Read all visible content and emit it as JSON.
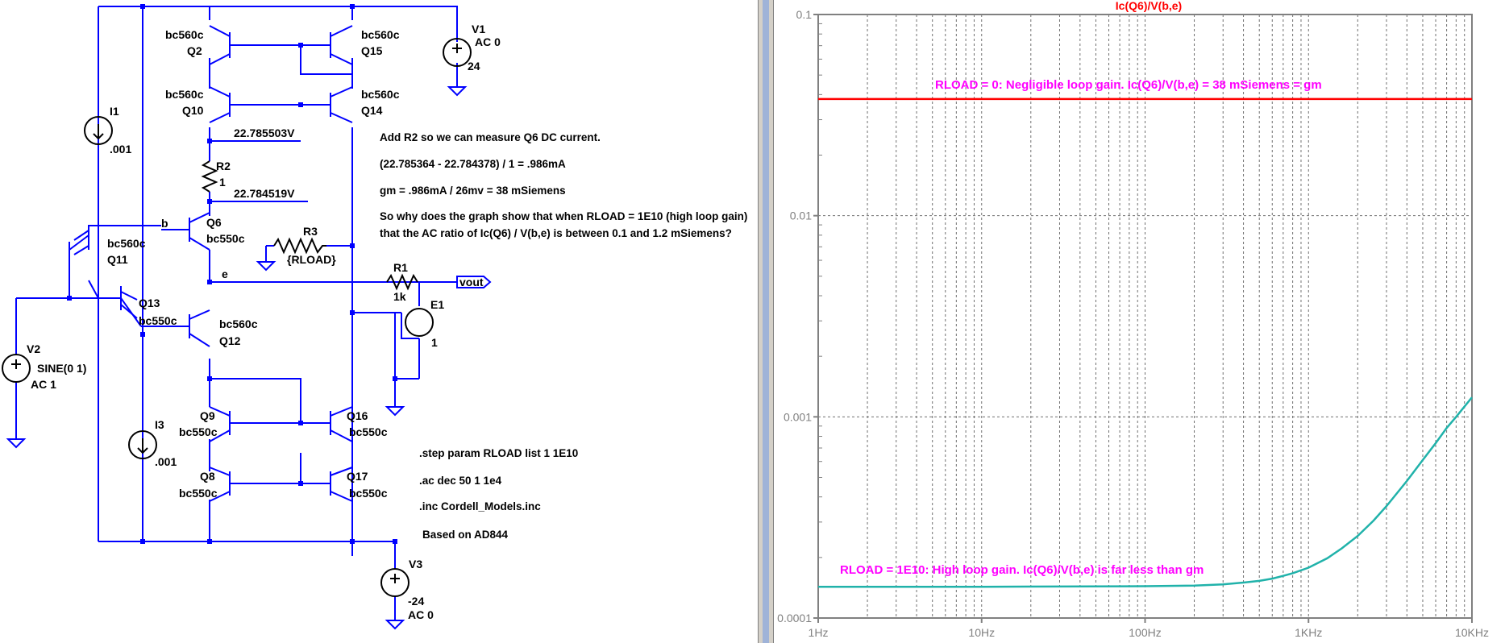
{
  "schematic": {
    "sources": {
      "v1": {
        "name": "V1",
        "value": "AC 0",
        "dc": "24"
      },
      "v2": {
        "name": "V2",
        "value": "SINE(0 1)",
        "ac": "AC 1"
      },
      "v3": {
        "name": "V3",
        "dc": "-24",
        "ac": "AC 0"
      },
      "i1": {
        "name": "I1",
        "value": ".001"
      },
      "i3": {
        "name": "I3",
        "value": ".001"
      },
      "e1": {
        "name": "E1",
        "gain": "1"
      }
    },
    "transistors": {
      "q2": {
        "name": "Q2",
        "model": "bc560c"
      },
      "q15": {
        "name": "Q15",
        "model": "bc560c"
      },
      "q10": {
        "name": "Q10",
        "model": "bc560c"
      },
      "q14": {
        "name": "Q14",
        "model": "bc560c"
      },
      "q6": {
        "name": "Q6",
        "model": "bc550c"
      },
      "q11": {
        "name": "Q11",
        "model": "bc560c"
      },
      "q13": {
        "name": "Q13",
        "model": "bc550c"
      },
      "q12": {
        "name": "Q12",
        "model": "bc560c"
      },
      "q9": {
        "name": "Q9",
        "model": "bc550c"
      },
      "q16": {
        "name": "Q16",
        "model": "bc550c"
      },
      "q8": {
        "name": "Q8",
        "model": "bc550c"
      },
      "q17": {
        "name": "Q17",
        "model": "bc550c"
      }
    },
    "resistors": {
      "r1": {
        "name": "R1",
        "value": "1k"
      },
      "r2": {
        "name": "R2",
        "value": "1"
      },
      "r3": {
        "name": "R3",
        "value": "{RLOAD}"
      }
    },
    "node_labels": {
      "b": "b",
      "e": "e",
      "vout": "vout"
    },
    "voltages": {
      "top": "22.785503V",
      "bottom": "22.784519V"
    },
    "notes": [
      "Add R2 so we can measure Q6 DC current.",
      "(22.785364 - 22.784378) / 1 = .986mA",
      "gm = .986mA / 26mv = 38 mSiemens",
      "So why does the graph show that when RLOAD = 1E10 (high loop gain)",
      "that the AC ratio of Ic(Q6) / V(b,e) is between 0.1 and 1.2 mSiemens?"
    ],
    "directives": [
      ".step param RLOAD list 1 1E10",
      ".ac dec 50 1 1e4",
      ".inc Cordell_Models.inc",
      "Based on AD844"
    ]
  },
  "chart_data": {
    "type": "line",
    "title": "Ic(Q6)/V(b,e)",
    "xscale": "log",
    "yscale": "log",
    "xlim": [
      1,
      10000
    ],
    "ylim": [
      0.0001,
      0.1
    ],
    "x_ticks": [
      "1Hz",
      "10Hz",
      "100Hz",
      "1KHz",
      "10KHz"
    ],
    "y_ticks": [
      "0.0001",
      "0.001",
      "0.01",
      "0.1"
    ],
    "grid": true,
    "colors": {
      "rload_0": "#ff0000",
      "rload_1e10": "#20b2aa",
      "annotation": "#ff00ff"
    },
    "series": [
      {
        "x": [
          1,
          10,
          100,
          1000,
          10000
        ],
        "y": [
          0.038,
          0.038,
          0.038,
          0.038,
          0.038
        ],
        "color": "#ff0000"
      },
      {
        "x": [
          1,
          10,
          100,
          200,
          300,
          400,
          500,
          600,
          700,
          800,
          1000,
          1300,
          1600,
          2000,
          2500,
          3000,
          4000,
          5000,
          6000,
          7000,
          8000,
          10000
        ],
        "y": [
          0.000143,
          0.000143,
          0.000144,
          0.000145,
          0.000147,
          0.00015,
          0.000153,
          0.000157,
          0.000162,
          0.000167,
          0.000178,
          0.000198,
          0.000222,
          0.000256,
          0.000305,
          0.00036,
          0.00048,
          0.00061,
          0.00074,
          0.00088,
          0.001,
          0.00125
        ],
        "color": "#20b2aa"
      }
    ],
    "annotations": [
      "RLOAD = 0: Negligible loop gain. Ic(Q6)/V(b,e) = 38 mSiemens = gm",
      "RLOAD = 1E10: High loop gain. Ic(Q6)/V(b,e) is far less than gm"
    ]
  }
}
